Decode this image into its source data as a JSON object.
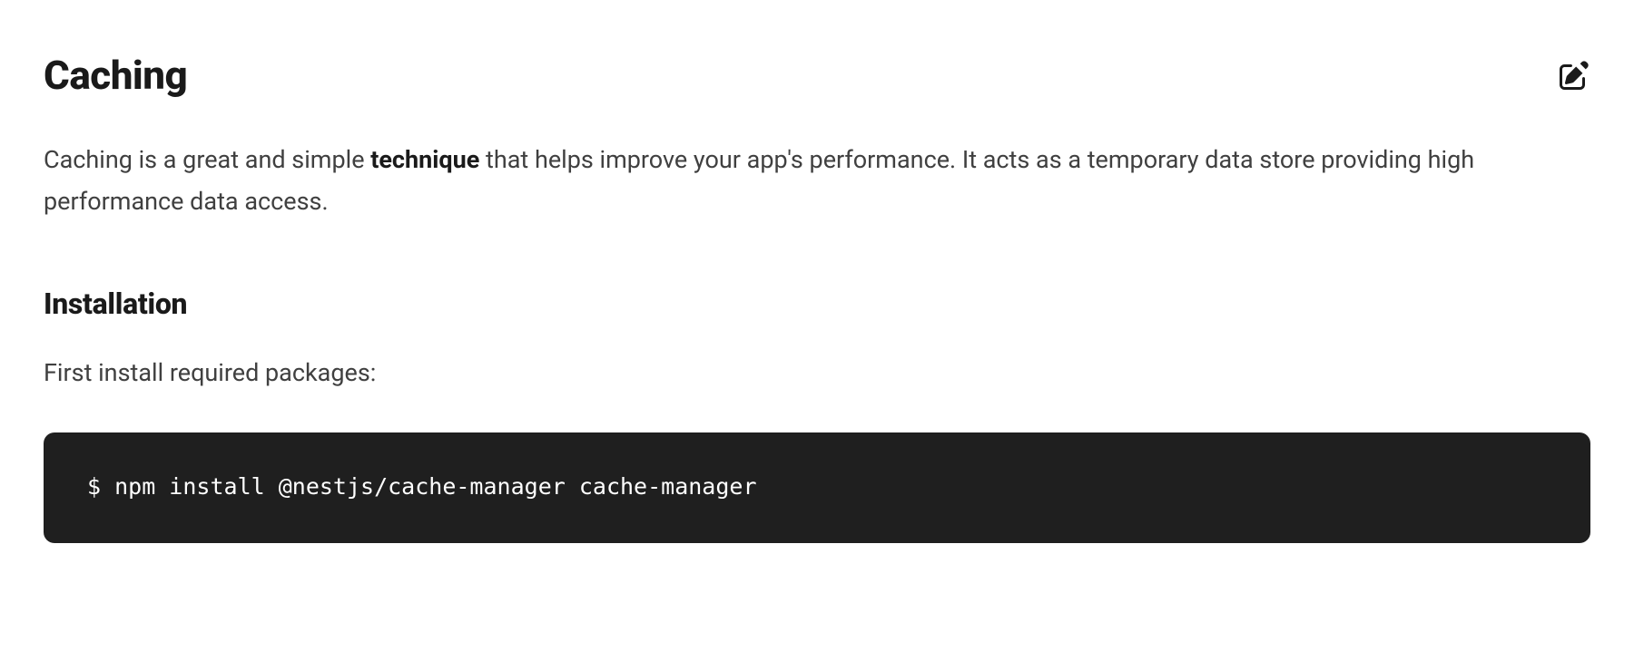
{
  "heading": "Caching",
  "intro": {
    "before_bold": "Caching is a great and simple ",
    "bold": "technique",
    "after_bold": " that helps improve your app's performance. It acts as a temporary data store providing high performance data access."
  },
  "section": {
    "heading": "Installation",
    "text": "First install required packages:"
  },
  "code": "$ npm install @nestjs/cache-manager cache-manager"
}
